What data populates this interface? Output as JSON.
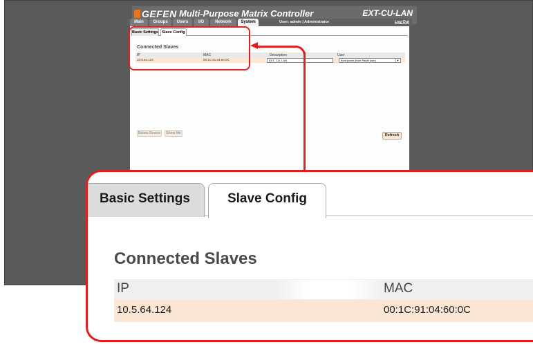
{
  "header": {
    "logo": "GEFEN",
    "app_title": "Multi-Purpose Matrix Controller",
    "device_name": "EXT-CU-LAN"
  },
  "nav": {
    "tabs": [
      "Main",
      "Groups",
      "Users",
      "I/O",
      "Network",
      "System"
    ],
    "active_tab": "System",
    "user_info": "User: admin  |  Administrator",
    "logout": "Log Out"
  },
  "subtabs": [
    "Basic Settings",
    "Slave Config"
  ],
  "active_subtab": "Slave Config",
  "section_title": "Connected Slaves",
  "table": {
    "columns": [
      "IP",
      "MAC",
      "Description",
      "User"
    ],
    "rows": [
      {
        "ip": "10.5.64.124",
        "mac": "00:1C:91:04:60:0C",
        "description": "EXT- CU- LAN",
        "user": "front panel (front Panel user)"
      }
    ]
  },
  "buttons": {
    "delete": "Delete Device",
    "show_me": "Show Me",
    "refresh": "Refresh"
  },
  "colors": {
    "highlight": "#e02020",
    "row_bg": "#fbe6d4",
    "logo_accent": "#e8741e"
  }
}
